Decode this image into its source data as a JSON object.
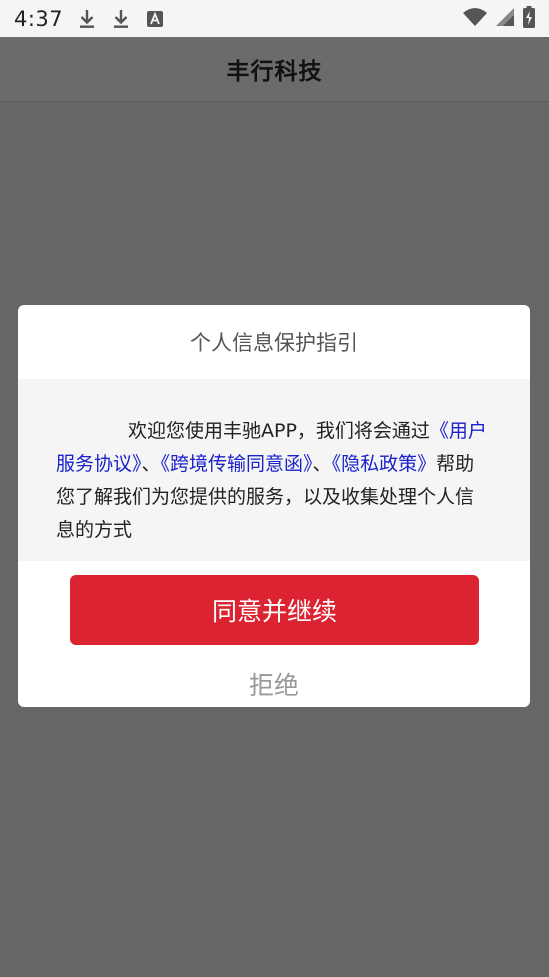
{
  "status_bar": {
    "time": "4:37",
    "icons_left": [
      "download-icon",
      "download-icon",
      "text-format-icon"
    ],
    "icons_right": [
      "wifi-icon",
      "signal-icon",
      "battery-charging-icon"
    ]
  },
  "app_bar": {
    "title": "丰行科技"
  },
  "dialog": {
    "title": "个人信息保护指引",
    "body": {
      "intro": "欢迎您使用丰驰APP，我们将会通过",
      "link_user_agreement": "《用户服务协议》",
      "sep1": "、",
      "link_cross_border": "《跨境传输同意函》",
      "sep2": "、",
      "link_privacy": "《隐私政策》",
      "outro": "帮助您了解我们为您提供的服务，以及收集处理个人信息的方式"
    },
    "agree_label": "同意并继续",
    "reject_label": "拒绝"
  },
  "colors": {
    "overlay": "#666666",
    "accent_red": "#dc2331",
    "link_blue": "#1a22cc"
  }
}
